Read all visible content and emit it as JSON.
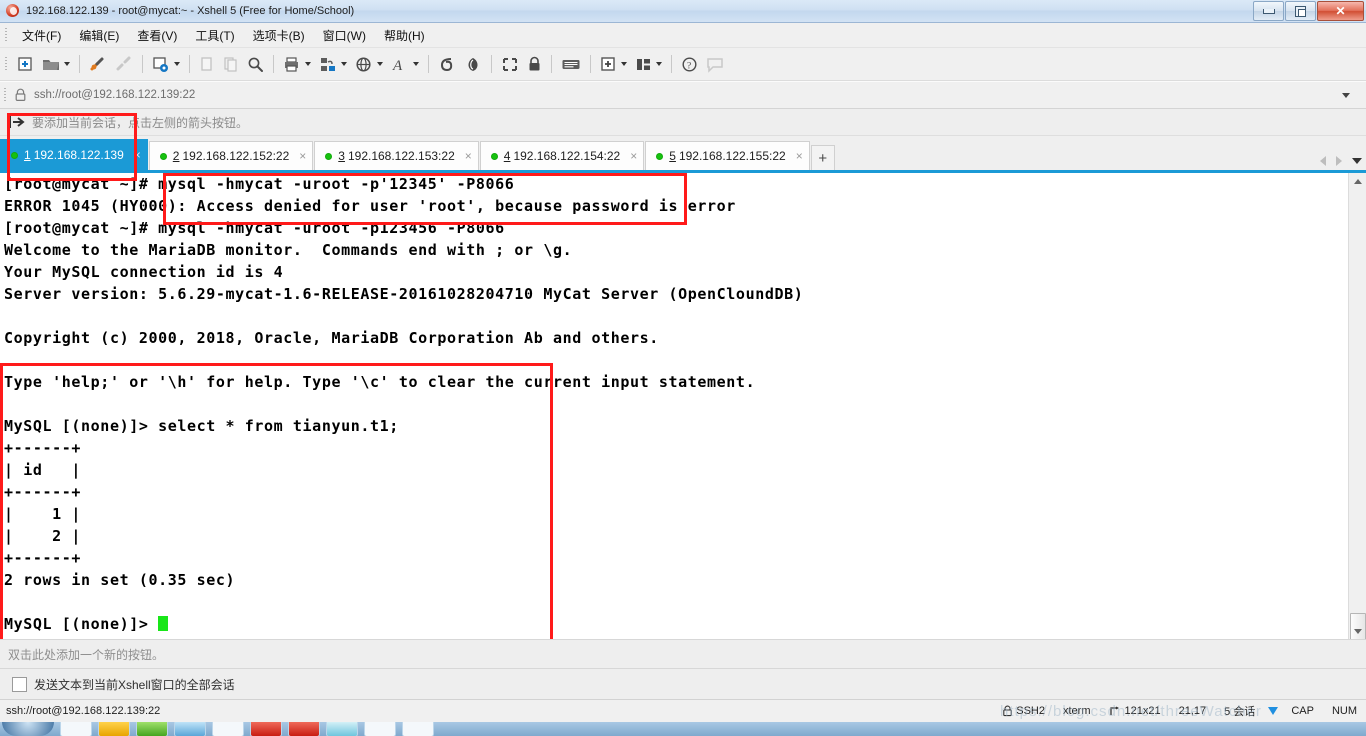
{
  "window": {
    "title": "192.168.122.139 - root@mycat:~ - Xshell 5 (Free for Home/School)",
    "app_icon": "xshell-icon",
    "minimize": "minimize",
    "maximize": "maximize",
    "close": "✕"
  },
  "menu": [
    {
      "label": "文件(F)",
      "name": "menu-file"
    },
    {
      "label": "编辑(E)",
      "name": "menu-edit"
    },
    {
      "label": "查看(V)",
      "name": "menu-view"
    },
    {
      "label": "工具(T)",
      "name": "menu-tools"
    },
    {
      "label": "选项卡(B)",
      "name": "menu-tabs"
    },
    {
      "label": "窗口(W)",
      "name": "menu-window"
    },
    {
      "label": "帮助(H)",
      "name": "menu-help"
    }
  ],
  "toolbar": [
    {
      "name": "new-session-icon",
      "tip": "新建会话"
    },
    {
      "name": "open-session-icon",
      "tip": "打开会话",
      "dropdown": true
    },
    {
      "name": "connect-icon",
      "tip": "连接"
    },
    {
      "name": "disconnect-icon",
      "tip": "断开",
      "disabled": true
    },
    {
      "name": "session-properties-icon",
      "tip": "属性",
      "dropdown": true
    },
    {
      "name": "copy-icon",
      "tip": "复制",
      "disabled": true
    },
    {
      "name": "paste-icon",
      "tip": "粘贴",
      "disabled": true
    },
    {
      "name": "find-icon",
      "tip": "查找"
    },
    {
      "name": "print-icon",
      "tip": "打印",
      "dropdown": true
    },
    {
      "name": "transfer-icon",
      "tip": "文件传输",
      "dropdown": true
    },
    {
      "name": "globe-icon",
      "tip": "编码",
      "dropdown": true
    },
    {
      "name": "font-icon",
      "tip": "字体",
      "dropdown": true
    },
    {
      "name": "xftp-icon",
      "tip": "Xftp"
    },
    {
      "name": "xagent-icon",
      "tip": "Xagent"
    },
    {
      "name": "fullscreen-icon",
      "tip": "全屏"
    },
    {
      "name": "lock-icon",
      "tip": "锁定"
    },
    {
      "name": "keyboard-icon",
      "tip": "键盘"
    },
    {
      "name": "add-pane-icon",
      "tip": "新建窗格",
      "dropdown": true
    },
    {
      "name": "layout-icon",
      "tip": "排列",
      "dropdown": true
    },
    {
      "name": "help-icon",
      "tip": "帮助"
    },
    {
      "name": "feedback-icon",
      "tip": "反馈",
      "disabled": true
    }
  ],
  "address": {
    "lock_icon": "lock-icon",
    "url": "ssh://root@192.168.122.139:22",
    "dropdown_icon": "chevron-down-icon"
  },
  "hint": {
    "arrow_icon": "add-session-arrow-icon",
    "text": "要添加当前会话，点击左侧的箭头按钮。"
  },
  "tabs": {
    "items": [
      {
        "num": "1",
        "label": "192.168.122.139",
        "active": true,
        "status": "connected",
        "close": "×"
      },
      {
        "num": "2",
        "label": "192.168.122.152:22",
        "active": false,
        "status": "connected",
        "close": "×"
      },
      {
        "num": "3",
        "label": "192.168.122.153:22",
        "active": false,
        "status": "connected",
        "close": "×"
      },
      {
        "num": "4",
        "label": "192.168.122.154:22",
        "active": false,
        "status": "connected",
        "close": "×"
      },
      {
        "num": "5",
        "label": "192.168.122.155:22",
        "active": false,
        "status": "connected",
        "close": "×"
      }
    ],
    "new_tab": "+",
    "scroll_left_icon": "chevron-left-icon",
    "scroll_right_icon": "chevron-right-icon",
    "tab_list_icon": "chevron-down-icon"
  },
  "terminal": {
    "lines": [
      "[root@mycat ~]# mysql -hmycat -uroot -p'12345' -P8066",
      "ERROR 1045 (HY000): Access denied for user 'root', because password is error",
      "[root@mycat ~]# mysql -hmycat -uroot -p123456 -P8066",
      "Welcome to the MariaDB monitor.  Commands end with ; or \\g.",
      "Your MySQL connection id is 4",
      "Server version: 5.6.29-mycat-1.6-RELEASE-20161028204710 MyCat Server (OpenCloundDB)",
      "",
      "Copyright (c) 2000, 2018, Oracle, MariaDB Corporation Ab and others.",
      "",
      "Type 'help;' or '\\h' for help. Type '\\c' to clear the current input statement.",
      "",
      "MySQL [(none)]> select * from tianyun.t1;",
      "+------+",
      "| id   |",
      "+------+",
      "|    1 |",
      "|    2 |",
      "+------+",
      "2 rows in set (0.35 sec)",
      "",
      "MySQL [(none)]> "
    ],
    "cursor": "block-cursor"
  },
  "quick_button_bar": {
    "text": "双击此处添加一个新的按钮。"
  },
  "send_bar": {
    "checked": false,
    "label": "发送文本到当前Xshell窗口的全部会话"
  },
  "statusbar": {
    "left": "ssh://root@192.168.122.139:22",
    "security_icon": "lock-icon",
    "protocol": "SSH2",
    "term_type": "xterm",
    "size_icon": "resize-icon",
    "size": "121x21",
    "cursor_pos": "21,17",
    "sessions": "5 会话",
    "transfer_icon": "download-arrow-icon",
    "caps": "CAP",
    "num": "NUM",
    "watermark": "https://blog.csdn.net/threeWatcher"
  }
}
